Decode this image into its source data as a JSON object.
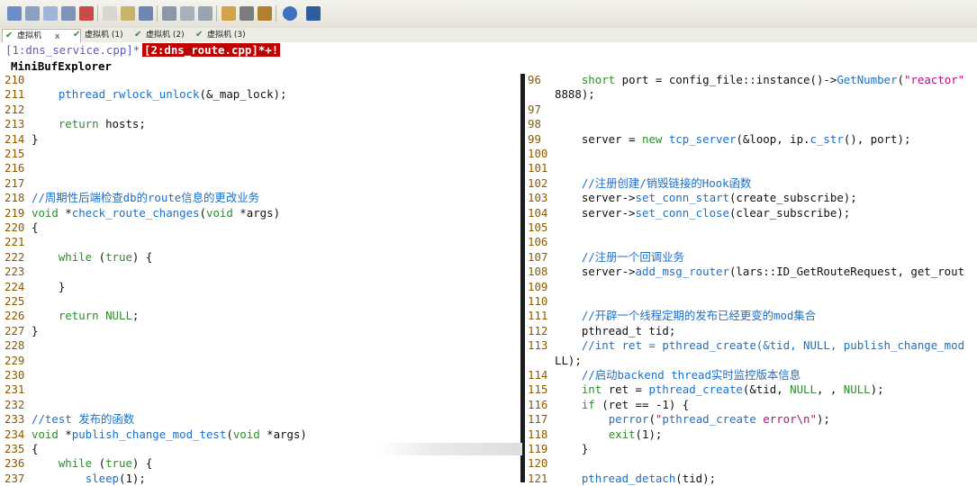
{
  "tabs": [
    {
      "label": "虚拟机",
      "active": true
    },
    {
      "label": "虚拟机 (1)",
      "active": false
    },
    {
      "label": "虚拟机 (2)",
      "active": false
    },
    {
      "label": "虚拟机 (3)",
      "active": false
    }
  ],
  "tab_close": "x",
  "buffers": {
    "buf1": "[1:dns_service.cpp]*",
    "buf2": "[2:dns_route.cpp]*+!"
  },
  "mbe_title": "MiniBufExplorer",
  "colors": {
    "accent_red": "#c00000",
    "keyword": "#2e8b2e",
    "function": "#1e6fc8",
    "line_number": "#8a5a00"
  },
  "left_lines": [
    {
      "num": "210",
      "code": ""
    },
    {
      "num": "211",
      "code": "    pthread_rwlock_unlock(&_map_lock);"
    },
    {
      "num": "212",
      "code": ""
    },
    {
      "num": "213",
      "code": "    return hosts;"
    },
    {
      "num": "214",
      "code": "}"
    },
    {
      "num": "215",
      "code": ""
    },
    {
      "num": "216",
      "code": ""
    },
    {
      "num": "217",
      "code": ""
    },
    {
      "num": "218",
      "code": "//周期性后端检查db的route信息的更改业务"
    },
    {
      "num": "219",
      "code": "void *check_route_changes(void *args)"
    },
    {
      "num": "220",
      "code": "{"
    },
    {
      "num": "221",
      "code": ""
    },
    {
      "num": "222",
      "code": "    while (true) {"
    },
    {
      "num": "223",
      "code": ""
    },
    {
      "num": "224",
      "code": "    }"
    },
    {
      "num": "225",
      "code": ""
    },
    {
      "num": "226",
      "code": "    return NULL;"
    },
    {
      "num": "227",
      "code": "}"
    },
    {
      "num": "228",
      "code": ""
    },
    {
      "num": "229",
      "code": ""
    },
    {
      "num": "230",
      "code": ""
    },
    {
      "num": "231",
      "code": ""
    },
    {
      "num": "232",
      "code": ""
    },
    {
      "num": "233",
      "code": "//test 发布的函数"
    },
    {
      "num": "234",
      "code": "void *publish_change_mod_test(void *args)"
    },
    {
      "num": "235",
      "code": "{"
    },
    {
      "num": "236",
      "code": "    while (true) {"
    },
    {
      "num": "237",
      "code": "        sleep(1);"
    }
  ],
  "right_lines": [
    {
      "num": "96",
      "code": "    short port = config_file::instance()->GetNumber(\"reactor\""
    },
    {
      "num": "",
      "code": "8888);"
    },
    {
      "num": "97",
      "code": ""
    },
    {
      "num": "98",
      "code": ""
    },
    {
      "num": "99",
      "code": "    server = new tcp_server(&loop, ip.c_str(), port);"
    },
    {
      "num": "100",
      "code": ""
    },
    {
      "num": "101",
      "code": ""
    },
    {
      "num": "102",
      "code": "    //注册创建/销毁链接的Hook函数"
    },
    {
      "num": "103",
      "code": "    server->set_conn_start(create_subscribe);"
    },
    {
      "num": "104",
      "code": "    server->set_conn_close(clear_subscribe);"
    },
    {
      "num": "105",
      "code": ""
    },
    {
      "num": "106",
      "code": ""
    },
    {
      "num": "107",
      "code": "    //注册一个回调业务"
    },
    {
      "num": "108",
      "code": "    server->add_msg_router(lars::ID_GetRouteRequest, get_rout"
    },
    {
      "num": "109",
      "code": ""
    },
    {
      "num": "110",
      "code": ""
    },
    {
      "num": "111",
      "code": "    //开辟一个线程定期的发布已经更变的mod集合"
    },
    {
      "num": "112",
      "code": "    pthread_t tid;"
    },
    {
      "num": "113",
      "code": "    //int ret = pthread_create(&tid, NULL, publish_change_mod"
    },
    {
      "num": "",
      "code": "LL);"
    },
    {
      "num": "114",
      "code": "    //启动backend thread实时监控版本信息"
    },
    {
      "num": "115",
      "code": "    int ret = pthread_create(&tid, NULL, , NULL);"
    },
    {
      "num": "116",
      "code": "    if (ret == -1) {"
    },
    {
      "num": "117",
      "code": "        perror(\"pthread_create error\\n\");"
    },
    {
      "num": "118",
      "code": "        exit(1);"
    },
    {
      "num": "119",
      "code": "    }"
    },
    {
      "num": "120",
      "code": ""
    },
    {
      "num": "121",
      "code": "    pthread_detach(tid);"
    }
  ]
}
